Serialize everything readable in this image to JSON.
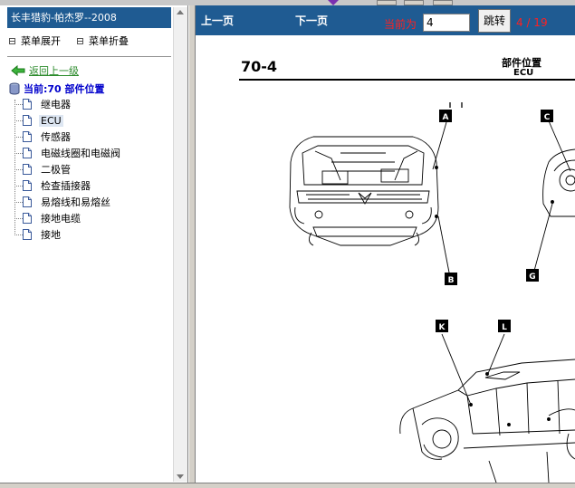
{
  "tree": {
    "title": "长丰猎豹-帕杰罗--2008",
    "expand_label": "菜单展开",
    "collapse_label": "菜单折叠",
    "back_label": "返回上一级",
    "current_label": "当前:70 部件位置",
    "items": [
      {
        "label": "继电器",
        "selected": false
      },
      {
        "label": "ECU",
        "selected": true
      },
      {
        "label": "传感器",
        "selected": false
      },
      {
        "label": "电磁线圈和电磁阀",
        "selected": false
      },
      {
        "label": "二极管",
        "selected": false
      },
      {
        "label": "检查插接器",
        "selected": false
      },
      {
        "label": "易熔线和易熔丝",
        "selected": false
      },
      {
        "label": "接地电缆",
        "selected": false
      },
      {
        "label": "接地",
        "selected": false
      }
    ]
  },
  "nav": {
    "prev_label": "上一页",
    "next_label": "下一页",
    "current_label": "当前为",
    "page_value": "4",
    "jump_label": "跳转",
    "page_count": "4 / 19"
  },
  "doc": {
    "section_number": "70-4",
    "title": "部件位置",
    "subtitle": "ECU",
    "callouts": [
      "A",
      "B",
      "C",
      "G",
      "K",
      "L"
    ]
  },
  "colors": {
    "title_bar": "#1f5b92",
    "accent_red": "#ff2020",
    "link_green": "#2a8a2a",
    "current_blue": "#0000cc"
  }
}
